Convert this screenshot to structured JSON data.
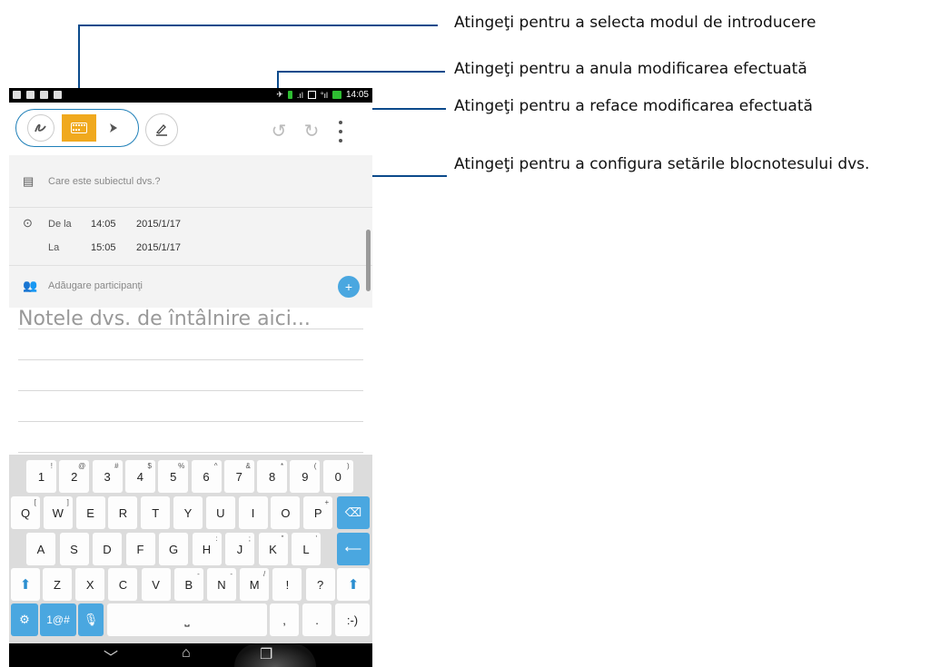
{
  "callouts": [
    {
      "text": "Atingeţi pentru a selecta modul de introducere"
    },
    {
      "text": "Atingeţi pentru a anula modificarea efectuată"
    },
    {
      "text": "Atingeţi pentru a reface modificarea efectuată"
    },
    {
      "text": "Atingeţi pentru a configura setările blocnotesului dvs."
    }
  ],
  "status_bar": {
    "time": "14:05"
  },
  "toolbar": {
    "handwriting_icon": "scribble-icon",
    "keyboard_icon": "keyboard-icon",
    "draw_icon": "brush-icon",
    "pen_icon": "pen-underline-icon",
    "undo_icon": "undo-icon",
    "redo_icon": "redo-icon",
    "menu_icon": "more-vertical-icon"
  },
  "form": {
    "subject_placeholder": "Care este subiectul dvs.?",
    "from_label": "De la",
    "from_time": "14:05",
    "from_date": "2015/1/17",
    "to_label": "La",
    "to_time": "15:05",
    "to_date": "2015/1/17",
    "participants_placeholder": "Adăugare participanţi"
  },
  "notes": {
    "placeholder": "Notele dvs. de întâlnire aici..."
  },
  "keyboard": {
    "row1": [
      [
        "1",
        "!"
      ],
      [
        "2",
        "@"
      ],
      [
        "3",
        "#"
      ],
      [
        "4",
        "$"
      ],
      [
        "5",
        "%"
      ],
      [
        "6",
        "^"
      ],
      [
        "7",
        "&"
      ],
      [
        "8",
        "*"
      ],
      [
        "9",
        "("
      ],
      [
        "0",
        ")"
      ]
    ],
    "row2": [
      [
        "Q",
        "["
      ],
      [
        "W",
        "]"
      ],
      [
        "E",
        ""
      ],
      [
        "R",
        ""
      ],
      [
        "T",
        ""
      ],
      [
        "Y",
        ""
      ],
      [
        "U",
        ""
      ],
      [
        "I",
        ""
      ],
      [
        "O",
        ""
      ],
      [
        "P",
        "+"
      ]
    ],
    "row3": [
      [
        "A",
        ""
      ],
      [
        "S",
        ""
      ],
      [
        "D",
        ""
      ],
      [
        "F",
        ""
      ],
      [
        "G",
        ""
      ],
      [
        "H",
        ":"
      ],
      [
        "J",
        ";"
      ],
      [
        "K",
        "\""
      ],
      [
        "L",
        "'"
      ]
    ],
    "row4": [
      [
        "Z",
        ""
      ],
      [
        "X",
        ""
      ],
      [
        "C",
        ""
      ],
      [
        "V",
        ""
      ],
      [
        "B",
        "-"
      ],
      [
        "N",
        "-"
      ],
      [
        "M",
        "/"
      ],
      [
        "!",
        ""
      ],
      [
        "?",
        ""
      ]
    ],
    "symbols_label": "1@#",
    "period": ".",
    "comma": ",",
    "smiley": ":-)"
  },
  "colors": {
    "accent": "#f0a91e",
    "callout": "#0b4a8b",
    "key_blue": "#4aa7e0"
  }
}
